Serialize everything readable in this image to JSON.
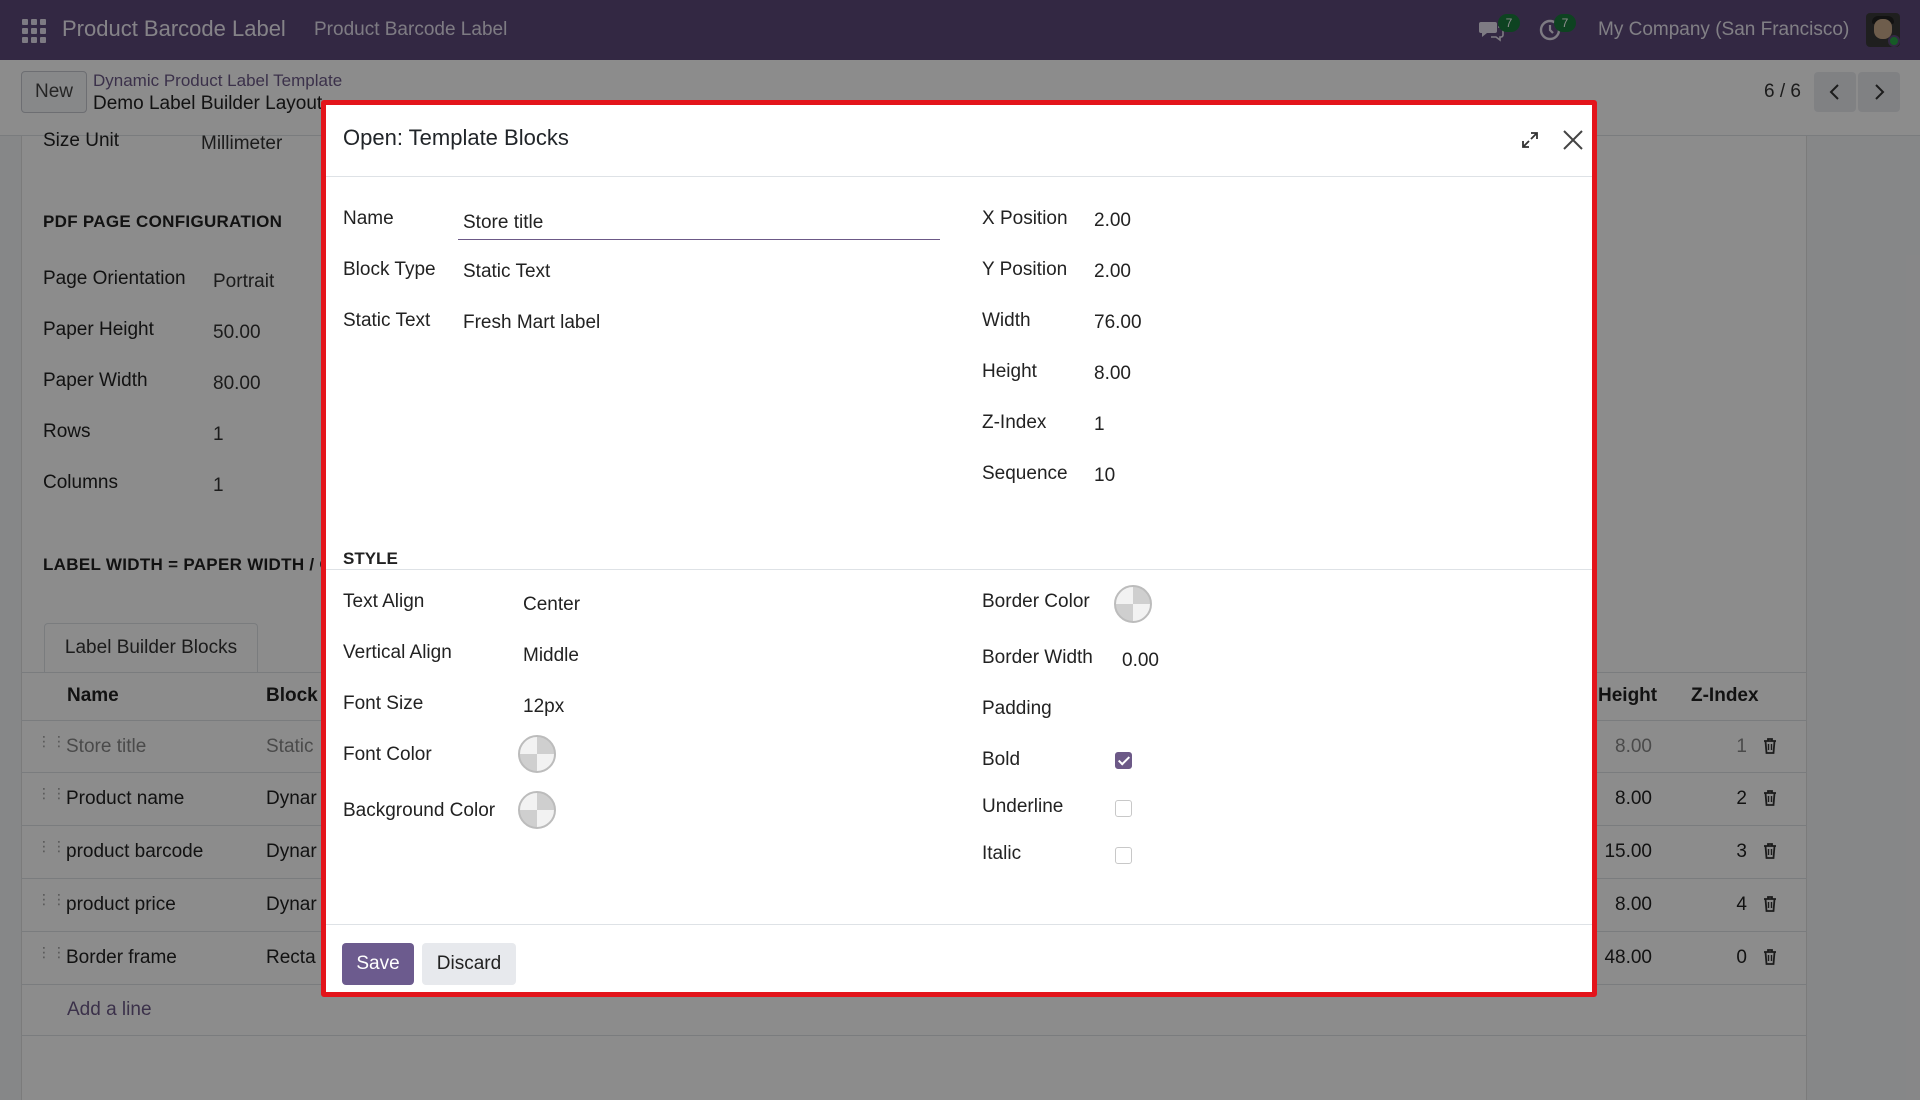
{
  "navbar": {
    "app_title": "Product Barcode Label",
    "menu_item": "Product Barcode Label",
    "messages_count": "7",
    "activities_count": "7",
    "company": "My Company (San Francisco)"
  },
  "control_panel": {
    "new_label": "New",
    "breadcrumb_parent": "Dynamic Product Label Template",
    "breadcrumb_current": "Demo Label Builder Layout",
    "pager": "6 / 6"
  },
  "form": {
    "size_unit_label": "Size Unit",
    "size_unit_value": "Millimeter",
    "pdf_section": "PDF PAGE CONFIGURATION",
    "fields": [
      {
        "label": "Page Orientation",
        "value": "Portrait"
      },
      {
        "label": "Paper Height",
        "value": "50.00"
      },
      {
        "label": "Paper Width",
        "value": "80.00"
      },
      {
        "label": "Rows",
        "value": "1"
      },
      {
        "label": "Columns",
        "value": "1"
      }
    ],
    "label_width_section": "LABEL WIDTH = PAPER WIDTH / C",
    "tab_label": "Label Builder Blocks",
    "columns": {
      "name": "Name",
      "block": "Block",
      "height": "Height",
      "zindex": "Z-Index"
    },
    "rows": [
      {
        "name": "Store title",
        "type": "Static",
        "height": "8.00",
        "z": "1"
      },
      {
        "name": "Product name",
        "type": "Dynar",
        "height": "8.00",
        "z": "2"
      },
      {
        "name": "product barcode",
        "type": "Dynar",
        "height": "15.00",
        "z": "3"
      },
      {
        "name": "product price",
        "type": "Dynar",
        "height": "8.00",
        "z": "4"
      },
      {
        "name": "Border frame",
        "type": "Recta",
        "height": "48.00",
        "z": "0"
      }
    ],
    "add_line": "Add a line"
  },
  "modal": {
    "title": "Open: Template Blocks",
    "name_label": "Name",
    "name_value": "Store title",
    "block_type_label": "Block Type",
    "block_type_value": "Static Text",
    "static_text_label": "Static Text",
    "static_text_value": "Fresh Mart label",
    "x_label": "X Position",
    "x_value": "2.00",
    "y_label": "Y Position",
    "y_value": "2.00",
    "width_label": "Width",
    "width_value": "76.00",
    "height_label": "Height",
    "height_value": "8.00",
    "z_label": "Z-Index",
    "z_value": "1",
    "seq_label": "Sequence",
    "seq_value": "10",
    "style_section": "STYLE",
    "text_align_label": "Text Align",
    "text_align_value": "Center",
    "valign_label": "Vertical Align",
    "valign_value": "Middle",
    "font_size_label": "Font Size",
    "font_size_value": "12px",
    "font_color_label": "Font Color",
    "bg_color_label": "Background Color",
    "border_color_label": "Border Color",
    "border_width_label": "Border Width",
    "border_width_value": "0.00",
    "padding_label": "Padding",
    "bold_label": "Bold",
    "bold_checked": true,
    "underline_label": "Underline",
    "underline_checked": false,
    "italic_label": "Italic",
    "italic_checked": false,
    "save_label": "Save",
    "discard_label": "Discard"
  },
  "colors": {
    "navbar": "#5d4a7a",
    "highlight_border": "#e3141b",
    "primary": "#6c5b8e"
  }
}
